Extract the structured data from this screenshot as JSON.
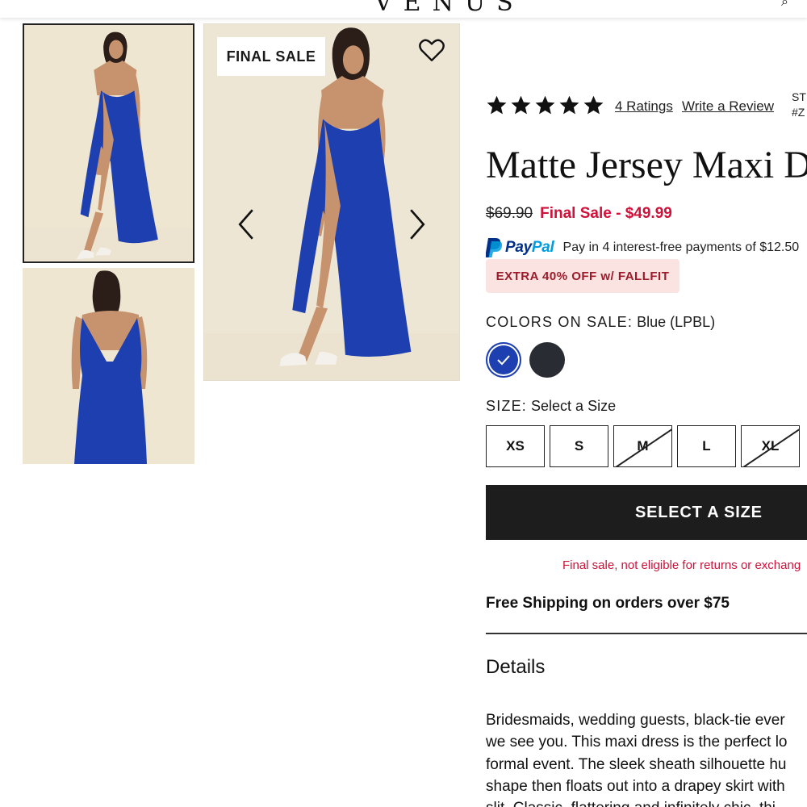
{
  "header": {
    "logo_text": "VENUS",
    "partial_icon": "⌕"
  },
  "gallery": {
    "thumbnails": [
      {
        "name": "front-view",
        "active": true
      },
      {
        "name": "back-view",
        "active": false
      }
    ],
    "main_badge": "FINAL SALE",
    "icons": {
      "favorite": "heart-icon",
      "prev": "chevron-left-icon",
      "next": "chevron-right-icon"
    }
  },
  "product": {
    "rating_stars": 5,
    "ratings_link": "4 Ratings",
    "write_review": "Write a Review",
    "style_line1": "ST",
    "style_line2": "#Z",
    "title": "Matte Jersey Maxi D",
    "original_price": "$69.90",
    "sale_price": "Final Sale - $49.99",
    "paypal": {
      "word_pay": "Pay",
      "word_pal": "Pal",
      "text": "Pay in 4 interest-free payments of $12.50"
    },
    "promo": "EXTRA 40% OFF w/ FALLFIT",
    "colors": {
      "label": "COLORS ON SALE:",
      "selected": "Blue (LPBL)",
      "swatches": [
        {
          "name": "Blue",
          "hex": "#1d3fb0",
          "selected": true
        },
        {
          "name": "Black",
          "hex": "#2a2c33",
          "selected": false
        }
      ]
    },
    "size": {
      "label": "SIZE:",
      "selected": "Select a Size",
      "options": [
        {
          "label": "XS",
          "available": true
        },
        {
          "label": "S",
          "available": true
        },
        {
          "label": "M",
          "available": false
        },
        {
          "label": "L",
          "available": true
        },
        {
          "label": "XL",
          "available": false
        }
      ]
    },
    "cta": "SELECT A SIZE",
    "final_note": "Final sale, not eligible for returns or exchang",
    "shipping": "Free Shipping on orders over $75",
    "details_heading": "Details",
    "description_lines": [
      "Bridesmaids, wedding guests, black-tie ever",
      "we see you. This maxi dress is the perfect lo",
      "formal event. The sleek sheath silhouette hu",
      "shape then floats out into a drapey skirt with",
      "slit. Classic, flattering and infinitely chic, thi"
    ]
  },
  "colors": {
    "dress_blue": "#1d3fb0",
    "sale_red": "#d0113a",
    "promo_bg": "#fbe3e1",
    "cta_bg": "#1d1d1d"
  }
}
